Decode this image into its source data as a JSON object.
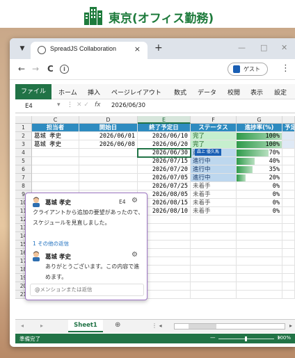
{
  "location": {
    "title": "東京(オフィス勤務)",
    "icon": "office-building-icon",
    "color": "#1e7b3c"
  },
  "browser": {
    "tab_title": "SpreadJS Collaboration",
    "tab_close": "×",
    "new_tab": "+",
    "win_min": "—",
    "win_max": "□",
    "win_close": "✕",
    "nav_back": "←",
    "nav_forward": "→",
    "nav_reload": "C",
    "info": "i",
    "guest_label": "ゲスト",
    "menu": "⋮"
  },
  "ribbon": {
    "file": "ファイル",
    "tabs": [
      "ホーム",
      "挿入",
      "ページレイアウト",
      "数式",
      "データ",
      "校閲",
      "表示",
      "設定"
    ]
  },
  "formula_bar": {
    "cell_ref": "E4",
    "fx": "fx",
    "value": "2026/06/30"
  },
  "grid": {
    "columns": [
      "C",
      "D",
      "E",
      "F",
      "G"
    ],
    "selected_column": "E",
    "rows": [
      "1",
      "2",
      "3",
      "4",
      "5",
      "6",
      "7",
      "8",
      "9",
      "10",
      "11",
      "12",
      "13",
      "14",
      "15",
      "16",
      "17",
      "18",
      "19",
      "20",
      "21"
    ],
    "header": [
      "担当者",
      "開始日",
      "終了予定日",
      "ステータス",
      "進捗率(%)",
      "予定"
    ],
    "data": [
      {
        "c": "葛城 孝史",
        "d": "2026/06/01",
        "e": "2026/06/10",
        "f": "完了",
        "g": "100%",
        "gv": 1.0,
        "status": "done"
      },
      {
        "c": "葛城 孝史",
        "d": "2026/06/08",
        "e": "2026/06/20",
        "f": "完了",
        "g": "100%",
        "gv": 1.0,
        "status": "done"
      },
      {
        "c": "",
        "d": "",
        "e": "2026/06/30",
        "f": "進行中",
        "g": "70%",
        "gv": 0.7,
        "status": "prog"
      },
      {
        "c": "",
        "d": "",
        "e": "2026/07/15",
        "f": "進行中",
        "g": "40%",
        "gv": 0.4,
        "status": "prog"
      },
      {
        "c": "",
        "d": "",
        "e": "2026/07/20",
        "f": "進行中",
        "g": "35%",
        "gv": 0.35,
        "status": "prog"
      },
      {
        "c": "",
        "d": "",
        "e": "2026/07/05",
        "f": "進行中",
        "g": "20%",
        "gv": 0.2,
        "status": "prog"
      },
      {
        "c": "",
        "d": "",
        "e": "2026/07/25",
        "f": "未着手",
        "g": "0%",
        "gv": 0,
        "status": "not"
      },
      {
        "c": "",
        "d": "",
        "e": "2026/08/05",
        "f": "未着手",
        "g": "0%",
        "gv": 0,
        "status": "not"
      },
      {
        "c": "",
        "d": "",
        "e": "2026/08/15",
        "f": "未着手",
        "g": "0%",
        "gv": 0,
        "status": "not"
      },
      {
        "c": "",
        "d": "",
        "e": "2026/08/10",
        "f": "未着手",
        "g": "0%",
        "gv": 0,
        "status": "not"
      }
    ],
    "user_flag": "森上 優久馬"
  },
  "comment": {
    "author": "葛城 孝史",
    "cell_ref": "E4",
    "text": "クライアントから追加の要望があったので、スケジュールを見直しました。",
    "replies_label": "1 その他の返信",
    "reply_author": "葛城 孝史",
    "reply_text": "ありがとうございます。この内容で進めます。",
    "reply_placeholder": "@メンションまたは返信"
  },
  "sheets": {
    "active": "Sheet1",
    "add": "⊕"
  },
  "status": {
    "ready": "準備完了",
    "zoom": "100%",
    "minus": "—",
    "plus": "+"
  }
}
